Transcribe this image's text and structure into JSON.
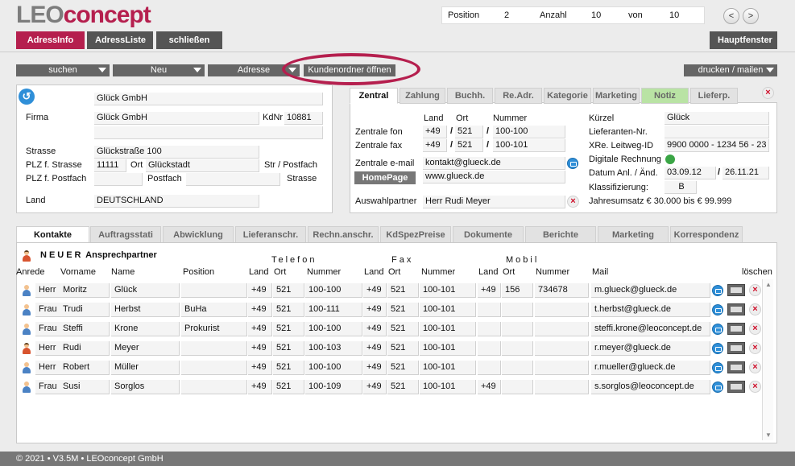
{
  "app": {
    "logo_part1": "LEO",
    "logo_part2": "concept",
    "brand_color": "#b51f4e"
  },
  "nav": {
    "position_label": "Position",
    "position_value": "2",
    "count_label": "Anzahl",
    "count_value": "10",
    "of_label": "von",
    "of_value": "10",
    "prev": "<",
    "next": ">"
  },
  "toolbar": {
    "tab_adressinfo": "AdressInfo",
    "tab_adressliste": "AdressListe",
    "close_label": "schließen",
    "main_window": "Hauptfenster"
  },
  "actions": {
    "search": "suchen",
    "new": "Neu",
    "address": "Adresse",
    "open_folder": "Kundenordner öffnen",
    "print_mail": "drucken / mailen"
  },
  "address": {
    "name1": "Glück GmbH",
    "firma_label": "Firma",
    "firma": "Glück GmbH",
    "kdnr_label": "KdNr",
    "kdnr": "10881",
    "strasse_label": "Strasse",
    "strasse": "Glückstraße 100",
    "plz_strasse_label": "PLZ f. Strasse",
    "plz": "11111",
    "ort_label": "Ort",
    "ort": "Glückstadt",
    "str_postfach_label": "Str / Postfach",
    "plz_postfach_label": "PLZ f. Postfach",
    "postfach_label": "Postfach",
    "strasse2_label": "Strasse",
    "land_label": "Land",
    "land": "DEUTSCHLAND"
  },
  "right_tabs": [
    "Zentral",
    "Zahlung",
    "Buchh.",
    "Re.Adr.",
    "Kategorie",
    "Marketing",
    "Notiz",
    "Lieferp."
  ],
  "zentral": {
    "land_hdr": "Land",
    "ort_hdr": "Ort",
    "nummer_hdr": "Nummer",
    "fon_label": "Zentrale fon",
    "fon_land": "+49",
    "fon_ort": "521",
    "fon_nr": "100-100",
    "fax_label": "Zentrale fax",
    "fax_land": "+49",
    "fax_ort": "521",
    "fax_nr": "100-101",
    "email_label": "Zentrale e-mail",
    "email": "kontakt@glueck.de",
    "homepage_btn": "HomePage",
    "homepage": "www.glueck.de",
    "partner_label": "Auswahlpartner",
    "partner": "Herr Rudi Meyer",
    "kuerzel_label": "Kürzel",
    "kuerzel": "Glück",
    "lieferanten_label": "Lieferanten-Nr.",
    "xre_label": "XRe. Leitweg-ID",
    "xre": "9900 0000 - 1234 56 - 23",
    "digital_label": "Digitale Rechnung",
    "datum_label": "Datum Anl. / Änd.",
    "datum_anl": "03.09.12",
    "datum_aend": "26.11.21",
    "klass_label": "Klassifizierung:",
    "klass": "B",
    "umsatz": "Jahresumsatz € 30.000 bis € 99.999",
    "slash": "/"
  },
  "bottom_tabs": [
    "Kontakte",
    "Auftragsstati",
    "Abwicklung",
    "Lieferanschr.",
    "Rechn.anschr.",
    "KdSpezPreise",
    "Dokumente",
    "Berichte",
    "Marketing",
    "Korrespondenz"
  ],
  "contacts": {
    "new_partner": "NEUER",
    "new_partner2": "Ansprechpartner",
    "telefon": "Telefon",
    "fax": "Fax",
    "mobil": "Mobil",
    "headers": {
      "anrede": "Anrede",
      "vorname": "Vorname",
      "name": "Name",
      "position": "Position",
      "land": "Land",
      "ort": "Ort",
      "nummer": "Nummer",
      "mail": "Mail",
      "loeschen": "löschen"
    },
    "rows": [
      {
        "anrede": "Herr",
        "vorname": "Moritz",
        "name": "Glück",
        "position": "",
        "t_land": "+49",
        "t_ort": "521",
        "t_nr": "100-100",
        "f_land": "+49",
        "f_ort": "521",
        "f_nr": "100-101",
        "m_land": "+49",
        "m_ort": "156",
        "m_nr": "734678",
        "mail": "m.glueck@glueck.de"
      },
      {
        "anrede": "Frau",
        "vorname": "Trudi",
        "name": "Herbst",
        "position": "BuHa",
        "t_land": "+49",
        "t_ort": "521",
        "t_nr": "100-111",
        "f_land": "+49",
        "f_ort": "521",
        "f_nr": "100-101",
        "m_land": "",
        "m_ort": "",
        "m_nr": "",
        "mail": "t.herbst@glueck.de"
      },
      {
        "anrede": "Frau",
        "vorname": "Steffi",
        "name": "Krone",
        "position": "Prokurist",
        "t_land": "+49",
        "t_ort": "521",
        "t_nr": "100-100",
        "f_land": "+49",
        "f_ort": "521",
        "f_nr": "100-101",
        "m_land": "",
        "m_ort": "",
        "m_nr": "",
        "mail": "steffi.krone@leoconcept.de"
      },
      {
        "anrede": "Herr",
        "vorname": "Rudi",
        "name": "Meyer",
        "position": "",
        "t_land": "+49",
        "t_ort": "521",
        "t_nr": "100-103",
        "f_land": "+49",
        "f_ort": "521",
        "f_nr": "100-101",
        "m_land": "",
        "m_ort": "",
        "m_nr": "",
        "mail": "r.meyer@glueck.de"
      },
      {
        "anrede": "Herr",
        "vorname": "Robert",
        "name": "Müller",
        "position": "",
        "t_land": "+49",
        "t_ort": "521",
        "t_nr": "100-100",
        "f_land": "+49",
        "f_ort": "521",
        "f_nr": "100-101",
        "m_land": "",
        "m_ort": "",
        "m_nr": "",
        "mail": "r.mueller@glueck.de"
      },
      {
        "anrede": "Frau",
        "vorname": "Susi",
        "name": "Sorglos",
        "position": "",
        "t_land": "+49",
        "t_ort": "521",
        "t_nr": "100-109",
        "f_land": "+49",
        "f_ort": "521",
        "f_nr": "100-101",
        "m_land": "+49",
        "m_ort": "",
        "m_nr": "",
        "mail": "s.sorglos@leoconcept.de"
      }
    ]
  },
  "footer": "© 2021 • V3.5M • LEOconcept GmbH"
}
